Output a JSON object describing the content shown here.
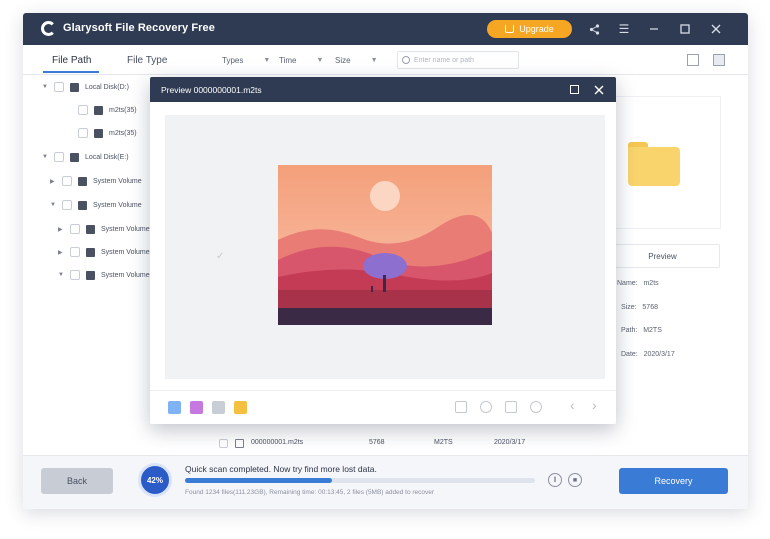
{
  "app": {
    "title": "Glarysoft File Recovery Free",
    "upgrade_label": "Upgrade",
    "accent_color": "#3a7bd5",
    "titlebar_color": "#2f3b52",
    "upgrade_color": "#f5a623"
  },
  "tabs": [
    {
      "label": "File Path",
      "active": true
    },
    {
      "label": "File Type",
      "active": false
    }
  ],
  "filters": [
    {
      "label": "Types"
    },
    {
      "label": "Time"
    },
    {
      "label": "Size"
    }
  ],
  "search": {
    "placeholder": "Enter name or path"
  },
  "tree": [
    {
      "label": "Local Disk(D:)",
      "expanded": true,
      "level": 0
    },
    {
      "label": "m2ts(35)",
      "level": 1
    },
    {
      "label": "m2ts(35)",
      "level": 1
    },
    {
      "label": "Local Disk(E:)",
      "expanded": true,
      "level": 0
    },
    {
      "label": "System Volume",
      "level": 1
    },
    {
      "label": "System Volume",
      "level": 1
    },
    {
      "label": "System Volume",
      "level": 2
    },
    {
      "label": "System Volume",
      "level": 2
    },
    {
      "label": "System Volume",
      "level": 2
    }
  ],
  "right_panel": {
    "preview_button": "Preview",
    "info": [
      {
        "label": "Name:",
        "value": "m2ts"
      },
      {
        "label": "Size:",
        "value": "5768"
      },
      {
        "label": "Path:",
        "value": "M2TS"
      },
      {
        "label": "Date:",
        "value": "2020/3/17"
      }
    ]
  },
  "file_row": {
    "name": "000000001.m2ts",
    "size": "5768",
    "type": "M2TS",
    "date": "2020/3/17"
  },
  "preview_dialog": {
    "title": "Preview 0000000001.m2ts"
  },
  "bottom": {
    "back_label": "Back",
    "progress_text": "42%",
    "progress_value": 0.42,
    "status_message": "Quick scan completed. Now try find more lost data.",
    "status_detail": "Found 1234 files(111.23GB), Remaining time: 00:13:45, 2 files (5MB) added to recover",
    "recovery_label": "Recovery"
  }
}
